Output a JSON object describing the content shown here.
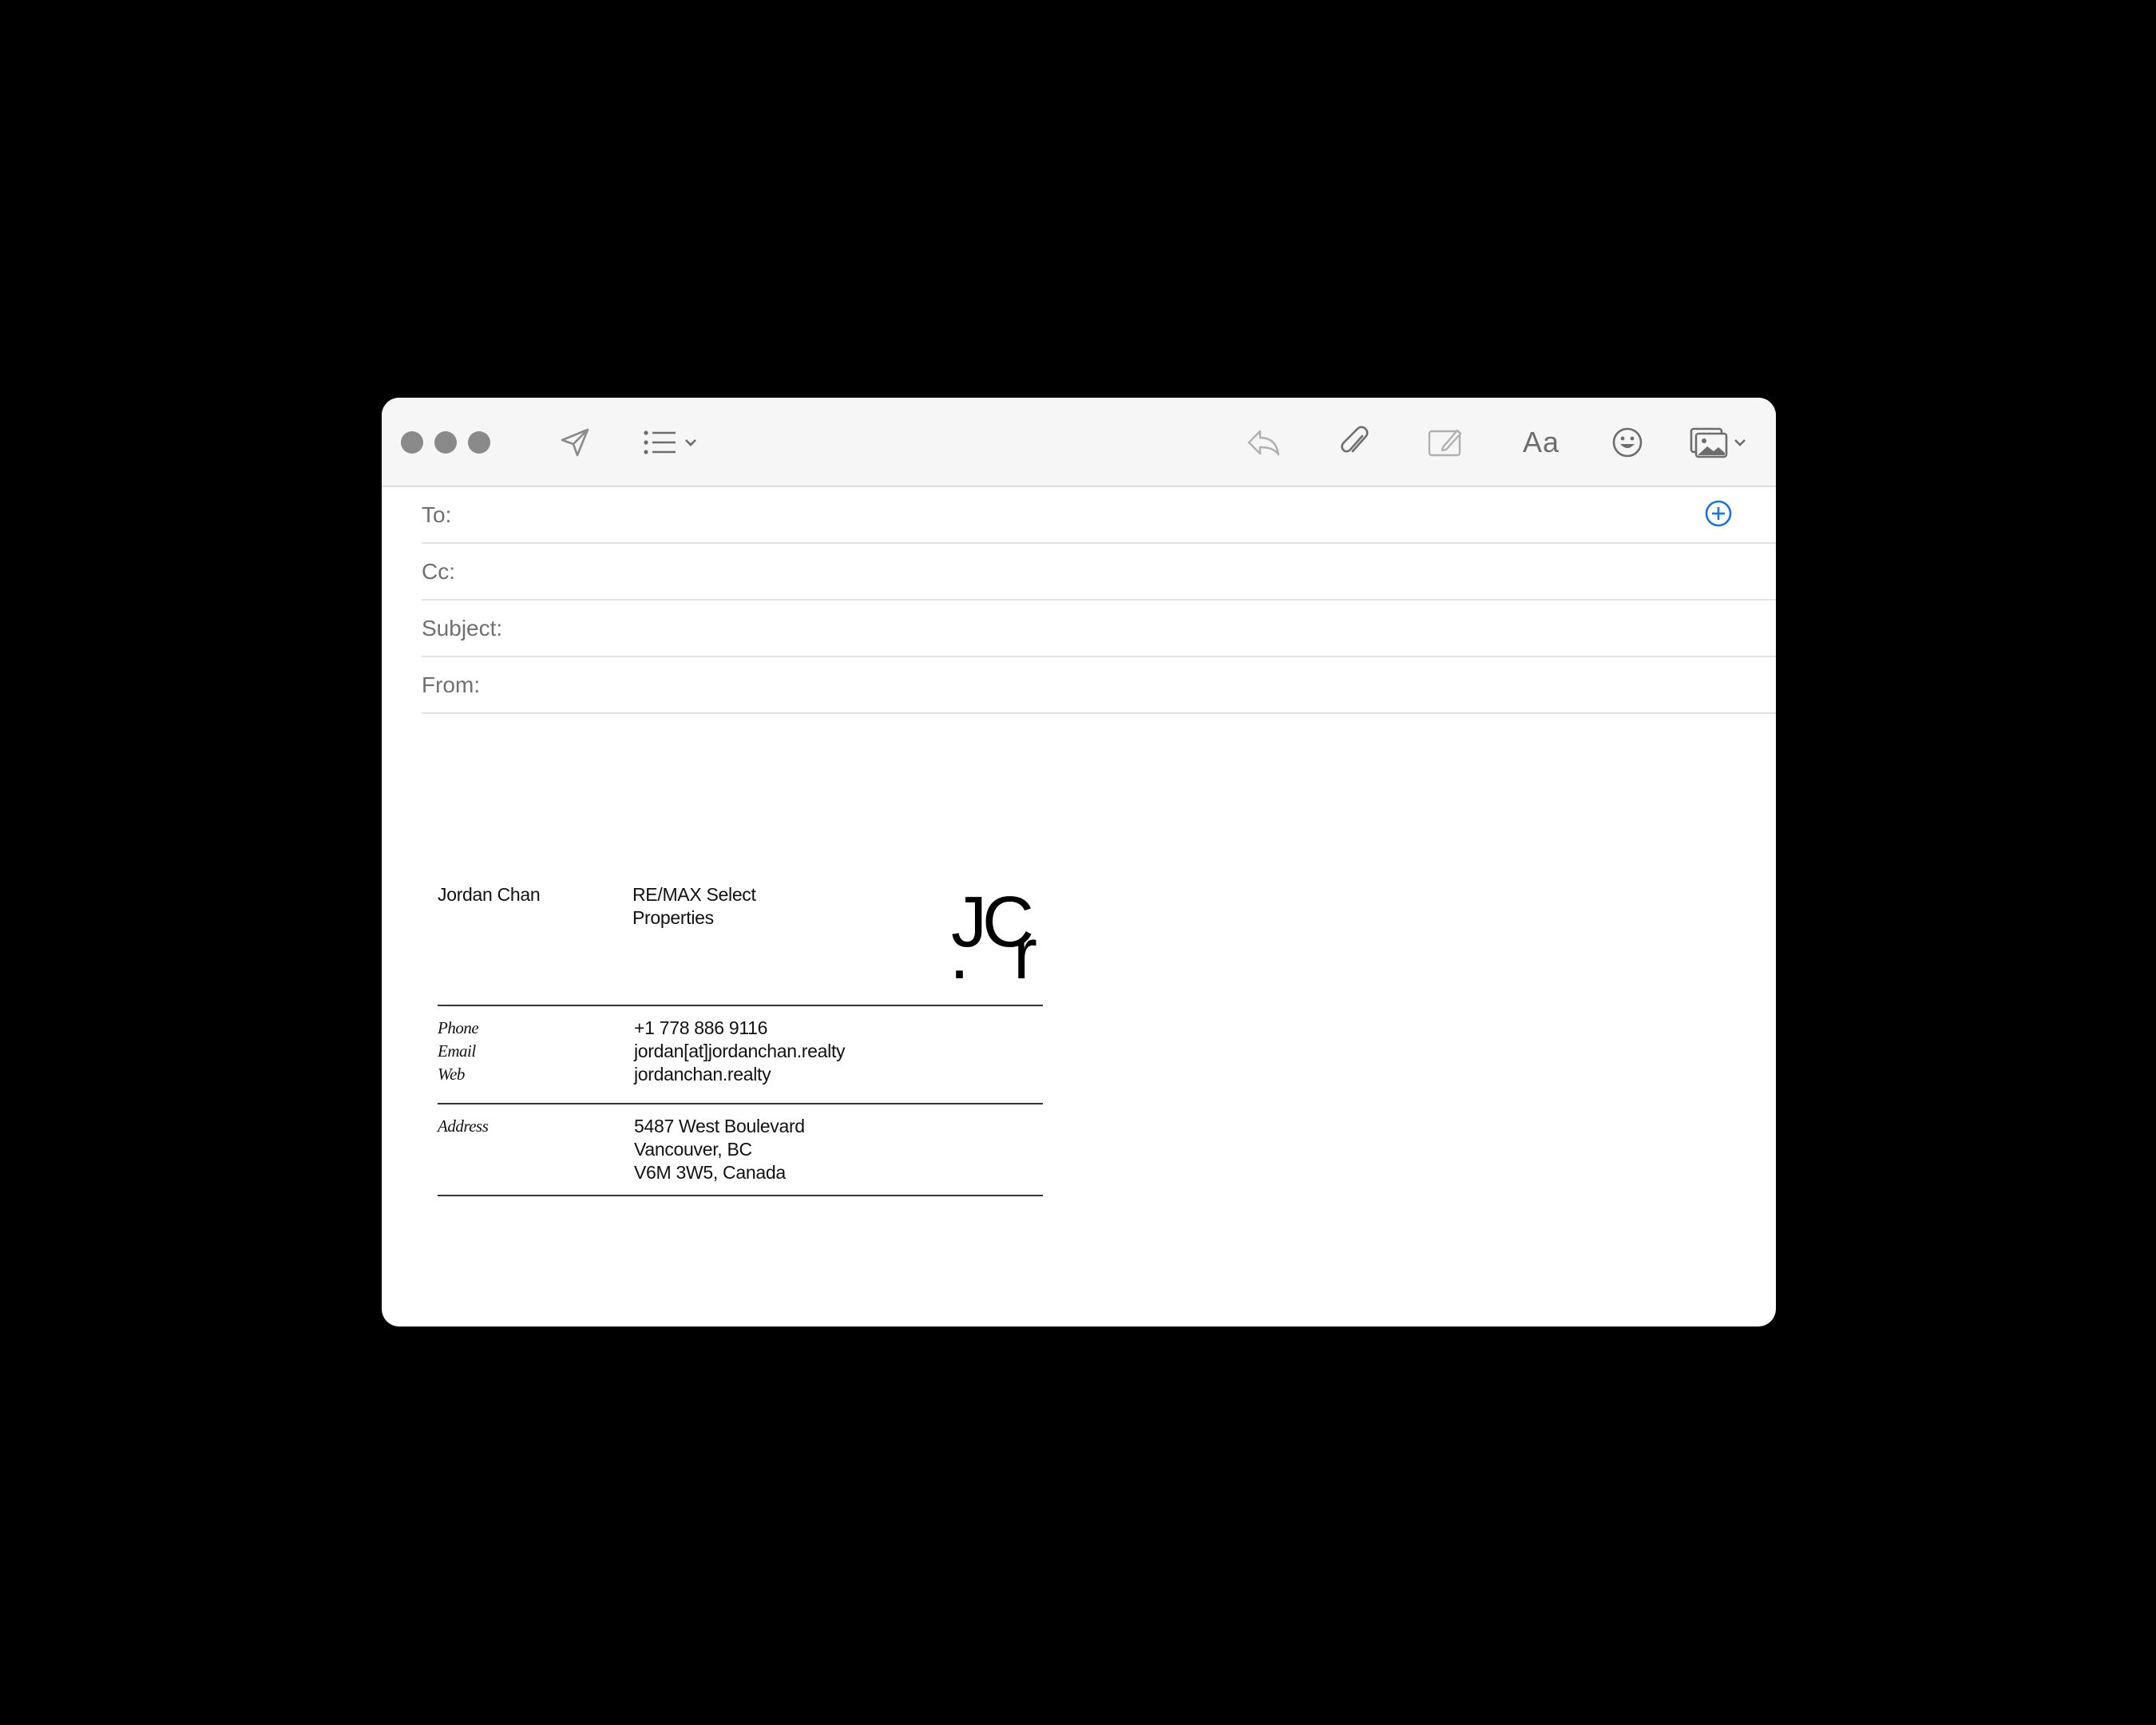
{
  "toolbar": {
    "icons": [
      "send-icon",
      "list-icon",
      "chevron-down-icon",
      "reply-icon",
      "attachment-icon",
      "markup-icon",
      "format-icon",
      "emoji-icon",
      "photo-browser-icon",
      "chevron-down-icon"
    ],
    "format_label": "Aa"
  },
  "header": {
    "to_label": "To:",
    "cc_label": "Cc:",
    "subject_label": "Subject:",
    "from_label": "From:"
  },
  "signature": {
    "name": "Jordan Chan",
    "company_line1": "RE/MAX Select",
    "company_line2": "Properties",
    "logo_line1": "JC",
    "logo_dot": ".",
    "logo_r": "r",
    "phone_label": "Phone",
    "email_label": "Email",
    "web_label": "Web",
    "phone": "+1 778 886 9116",
    "email": "jordan[at]jordanchan.realty",
    "web": "jordanchan.realty",
    "address_label": "Address",
    "address_line1": "5487 West Boulevard",
    "address_line2": "Vancouver, BC",
    "address_line3": "V6M 3W5, Canada"
  },
  "colors": {
    "background": "#000000",
    "toolbar": "#f6f6f6",
    "accent": "#1a73e8",
    "icon": "#777777"
  }
}
